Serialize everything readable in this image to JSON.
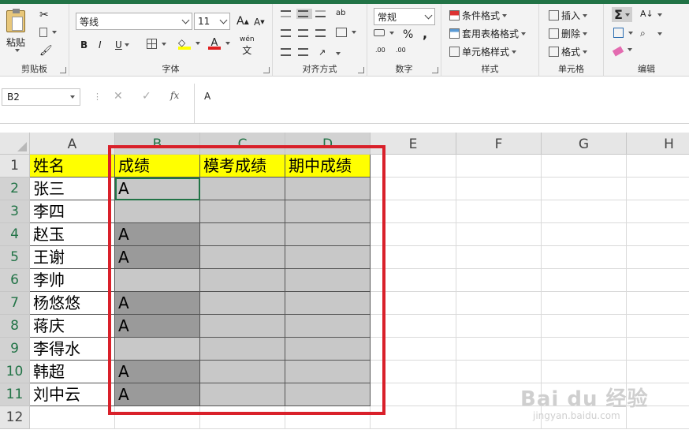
{
  "ribbon": {
    "clipboard": {
      "paste": "粘贴",
      "label": "剪贴板"
    },
    "font": {
      "name": "等线",
      "size": "11",
      "bold": "B",
      "italic": "I",
      "underline": "U",
      "grow": "A",
      "shrink": "A",
      "label": "字体",
      "wen": "wén",
      "wen_char": "文"
    },
    "alignment": {
      "label": "对齐方式",
      "wrap": "ab"
    },
    "number": {
      "format": "常规",
      "percent": "%",
      "comma": ",",
      "inc": ".00",
      "dec": ".00",
      "label": "数字"
    },
    "styles": {
      "conditional": "条件格式",
      "table": "套用表格格式",
      "cell": "单元格样式",
      "label": "样式"
    },
    "cells": {
      "insert": "插入",
      "delete": "删除",
      "format": "格式",
      "label": "单元格"
    },
    "editing": {
      "sigma": "Σ",
      "label": "编辑"
    }
  },
  "formula_bar": {
    "name_box": "B2",
    "fx": "fx",
    "content": "A"
  },
  "columns": [
    "A",
    "B",
    "C",
    "D",
    "E",
    "F",
    "G",
    "H"
  ],
  "rows": [
    "1",
    "2",
    "3",
    "4",
    "5",
    "6",
    "7",
    "8",
    "9",
    "10",
    "11",
    "12"
  ],
  "cells": {
    "A1": "姓名",
    "B1": "成绩",
    "C1": "模考成绩",
    "D1": "期中成绩",
    "A2": "张三",
    "B2": "A",
    "A3": "李四",
    "A4": "赵玉",
    "B4": "A",
    "A5": "王谢",
    "B5": "A",
    "A6": "李帅",
    "A7": "杨悠悠",
    "B7": "A",
    "A8": "蒋庆",
    "B8": "A",
    "A9": "李得水",
    "A10": "韩超",
    "B10": "A",
    "A11": "刘中云",
    "B11": "A"
  },
  "watermark": {
    "brand": "Bai du 经验",
    "url": "jingyan.baidu.com"
  },
  "colors": {
    "accent": "#217346",
    "highlight": "#ffff00",
    "annotation": "#d9202a"
  }
}
